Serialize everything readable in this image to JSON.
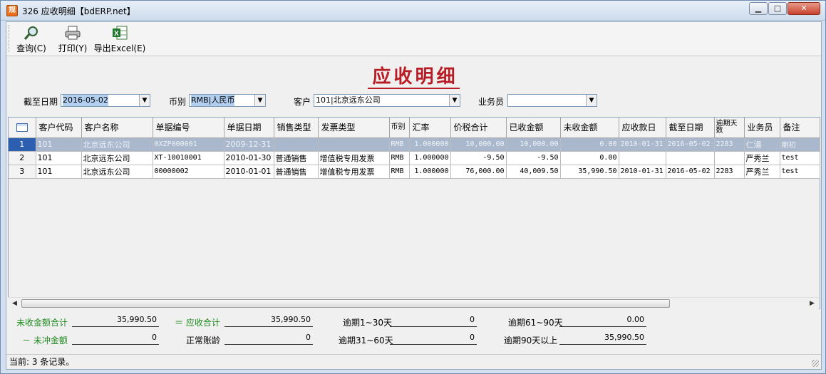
{
  "window": {
    "title": "326 应收明细【bdERP.net】",
    "icon_char": "规"
  },
  "toolbar": {
    "query_label": "查询(C)",
    "print_label": "打印(Y)",
    "export_label": "导出Excel(E)"
  },
  "report_title": "应收明细",
  "filters": {
    "cutoff_label": "截至日期",
    "cutoff_value": "2016-05-02",
    "currency_label": "币别",
    "currency_value": "RMB|人民币",
    "customer_label": "客户",
    "customer_value": "101|北京远东公司",
    "salesman_label": "业务员",
    "salesman_value": ""
  },
  "grid": {
    "headers": [
      "客户代码",
      "客户名称",
      "单据编号",
      "单据日期",
      "销售类型",
      "发票类型",
      "币别",
      "汇率",
      "价税合计",
      "已收金额",
      "未收金额",
      "应收款日",
      "截至日期",
      "逾期天数",
      "业务员",
      "备注"
    ],
    "rows": [
      {
        "no": "1",
        "cells": [
          "101",
          "北京远东公司",
          "0XZP000001",
          "2009-12-31",
          "",
          "",
          "RMB",
          "1.000000",
          "10,000.00",
          "10,000.00",
          "0.00",
          "2010-01-31",
          "2016-05-02",
          "2283",
          "仁湯",
          "期初"
        ]
      },
      {
        "no": "2",
        "cells": [
          "101",
          "北京远东公司",
          "XT-10010001",
          "2010-01-30",
          "普通销售",
          "增值税专用发票",
          "RMB",
          "1.000000",
          "-9.50",
          "-9.50",
          "0.00",
          "",
          "",
          "",
          "严秀兰",
          "test"
        ]
      },
      {
        "no": "3",
        "cells": [
          "101",
          "北京远东公司",
          "00000002",
          "2010-01-01",
          "普通销售",
          "增值税专用发票",
          "RMB",
          "1.000000",
          "76,000.00",
          "40,009.50",
          "35,990.50",
          "2010-01-31",
          "2016-05-02",
          "2283",
          "严秀兰",
          "test"
        ]
      }
    ],
    "selected_row": 1
  },
  "summary": {
    "unreceived_total_label": "未收金额合计",
    "unreceived_total_value": "35,990.50",
    "unoffset_label": "－ 未冲金额",
    "unoffset_value": "0",
    "equals_label": "＝ 应收合计",
    "receivable_total_value": "35,990.50",
    "normal_age_label": "正常账龄",
    "normal_age_value": "0",
    "overdue_1_30_label": "逾期1~30天",
    "overdue_1_30_value": "0",
    "overdue_31_60_label": "逾期31~60天",
    "overdue_31_60_value": "0",
    "overdue_61_90_label": "逾期61~90天",
    "overdue_61_90_value": "0.00",
    "overdue_90_plus_label": "逾期90天以上",
    "overdue_90_plus_value": "35,990.50"
  },
  "status": {
    "text": "当前: 3 条记录。"
  },
  "colors": {
    "title_red": "#b81c24",
    "summary_green": "#1e8a1e",
    "selected_row": "#aab8cd"
  }
}
